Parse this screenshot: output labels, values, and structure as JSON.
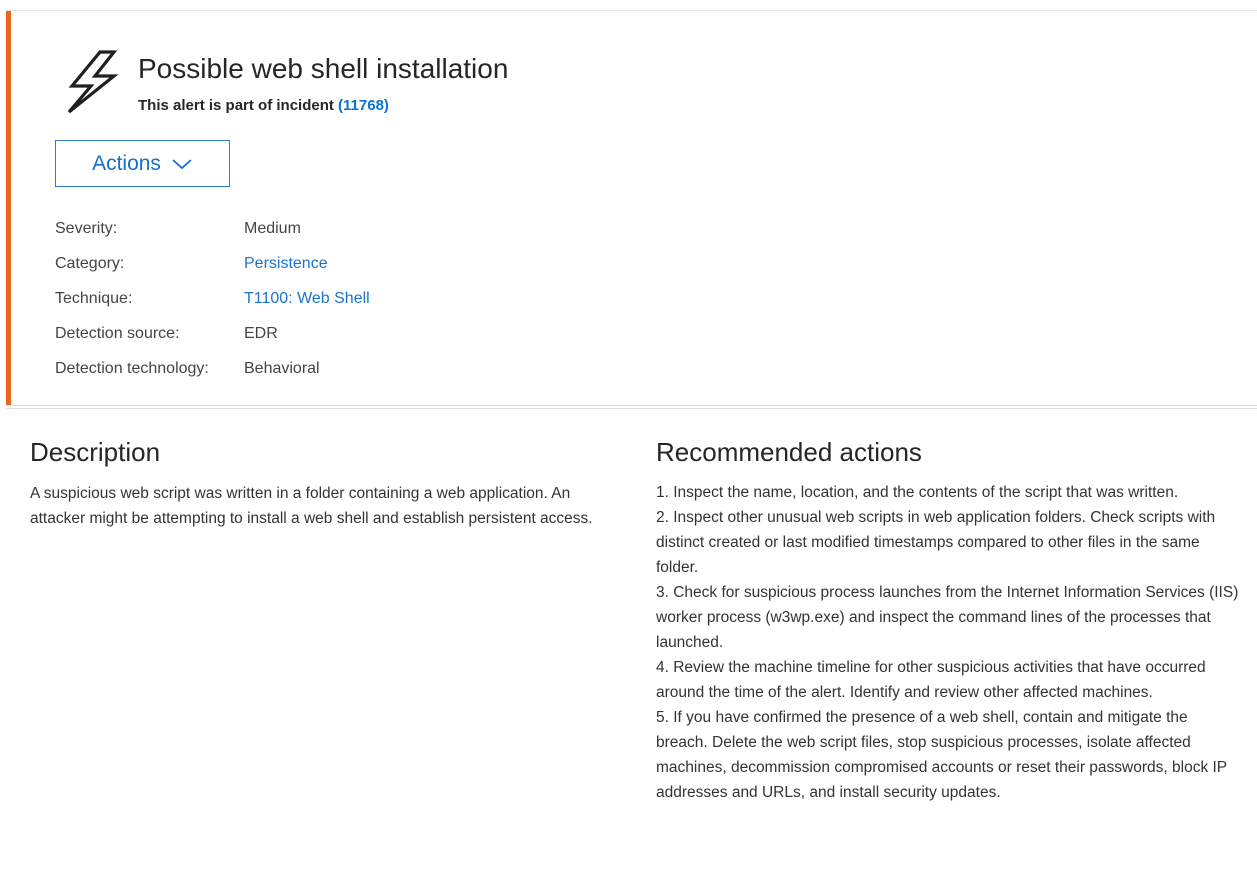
{
  "alert": {
    "icon": "lightning-bolt-icon",
    "title": "Possible web shell installation",
    "incident_prefix": "This alert is part of incident ",
    "incident_link": "(11768)",
    "actions_label": "Actions",
    "accent_color": "#e8671c",
    "link_color": "#1a73d0"
  },
  "properties": [
    {
      "label": "Severity:",
      "value": "Medium",
      "is_link": false
    },
    {
      "label": "Category:",
      "value": "Persistence",
      "is_link": true
    },
    {
      "label": "Technique:",
      "value": "T1100: Web Shell",
      "is_link": true
    },
    {
      "label": "Detection source:",
      "value": "EDR",
      "is_link": false
    },
    {
      "label": "Detection technology:",
      "value": "Behavioral",
      "is_link": false
    }
  ],
  "description": {
    "heading": "Description",
    "text": "A suspicious web script was written in a folder containing a web application. An attacker might be attempting to install a web shell and establish persistent access."
  },
  "recommended": {
    "heading": "Recommended actions",
    "items": [
      "1. Inspect the name, location, and the contents of the script that was written.",
      "2. Inspect other unusual web scripts in web application folders. Check scripts with distinct created or last modified timestamps compared to other files in the same folder.",
      "3. Check for suspicious process launches from the Internet Information Services (IIS) worker process (w3wp.exe) and inspect the command lines of the processes that launched.",
      "4. Review the machine timeline for other suspicious activities that have occurred around the time of the alert. Identify and review other affected machines.",
      "5. If you have confirmed the presence of a web shell, contain and mitigate the breach. Delete the web script files, stop suspicious processes, isolate affected machines, decommission compromised accounts or reset their passwords, block IP addresses and URLs, and install security updates."
    ]
  }
}
